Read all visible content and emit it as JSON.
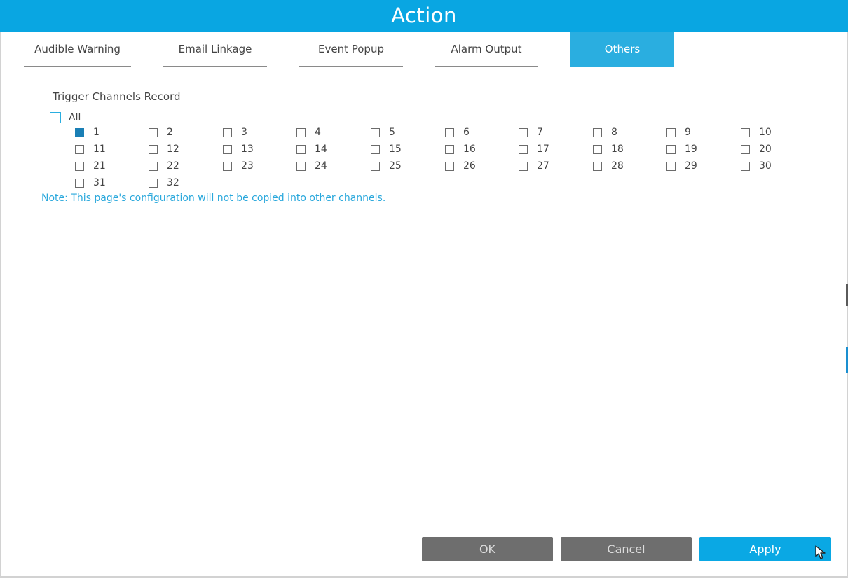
{
  "window": {
    "title": "Action"
  },
  "tabs": [
    {
      "label": "Audible Warning",
      "active": false
    },
    {
      "label": "Email Linkage",
      "active": false
    },
    {
      "label": "Event Popup",
      "active": false
    },
    {
      "label": "Alarm Output",
      "active": false
    },
    {
      "label": "Others",
      "active": true
    }
  ],
  "trigger": {
    "title": "Trigger Channels Record",
    "all_label": "All",
    "all_checked": false,
    "channels": [
      {
        "label": "1",
        "checked": true
      },
      {
        "label": "2",
        "checked": false
      },
      {
        "label": "3",
        "checked": false
      },
      {
        "label": "4",
        "checked": false
      },
      {
        "label": "5",
        "checked": false
      },
      {
        "label": "6",
        "checked": false
      },
      {
        "label": "7",
        "checked": false
      },
      {
        "label": "8",
        "checked": false
      },
      {
        "label": "9",
        "checked": false
      },
      {
        "label": "10",
        "checked": false
      },
      {
        "label": "11",
        "checked": false
      },
      {
        "label": "12",
        "checked": false
      },
      {
        "label": "13",
        "checked": false
      },
      {
        "label": "14",
        "checked": false
      },
      {
        "label": "15",
        "checked": false
      },
      {
        "label": "16",
        "checked": false
      },
      {
        "label": "17",
        "checked": false
      },
      {
        "label": "18",
        "checked": false
      },
      {
        "label": "19",
        "checked": false
      },
      {
        "label": "20",
        "checked": false
      },
      {
        "label": "21",
        "checked": false
      },
      {
        "label": "22",
        "checked": false
      },
      {
        "label": "23",
        "checked": false
      },
      {
        "label": "24",
        "checked": false
      },
      {
        "label": "25",
        "checked": false
      },
      {
        "label": "26",
        "checked": false
      },
      {
        "label": "27",
        "checked": false
      },
      {
        "label": "28",
        "checked": false
      },
      {
        "label": "29",
        "checked": false
      },
      {
        "label": "30",
        "checked": false
      },
      {
        "label": "31",
        "checked": false
      },
      {
        "label": "32",
        "checked": false
      }
    ]
  },
  "note": "Note: This page's configuration will not be copied into other channels.",
  "buttons": {
    "ok": "OK",
    "cancel": "Cancel",
    "apply": "Apply"
  },
  "colors": {
    "accent": "#09a6e2",
    "checked": "#1a7fb5",
    "note": "#2aa8dc",
    "button_gray": "#6e6e6e"
  },
  "icons": {
    "cursor": "mouse-pointer-icon"
  }
}
